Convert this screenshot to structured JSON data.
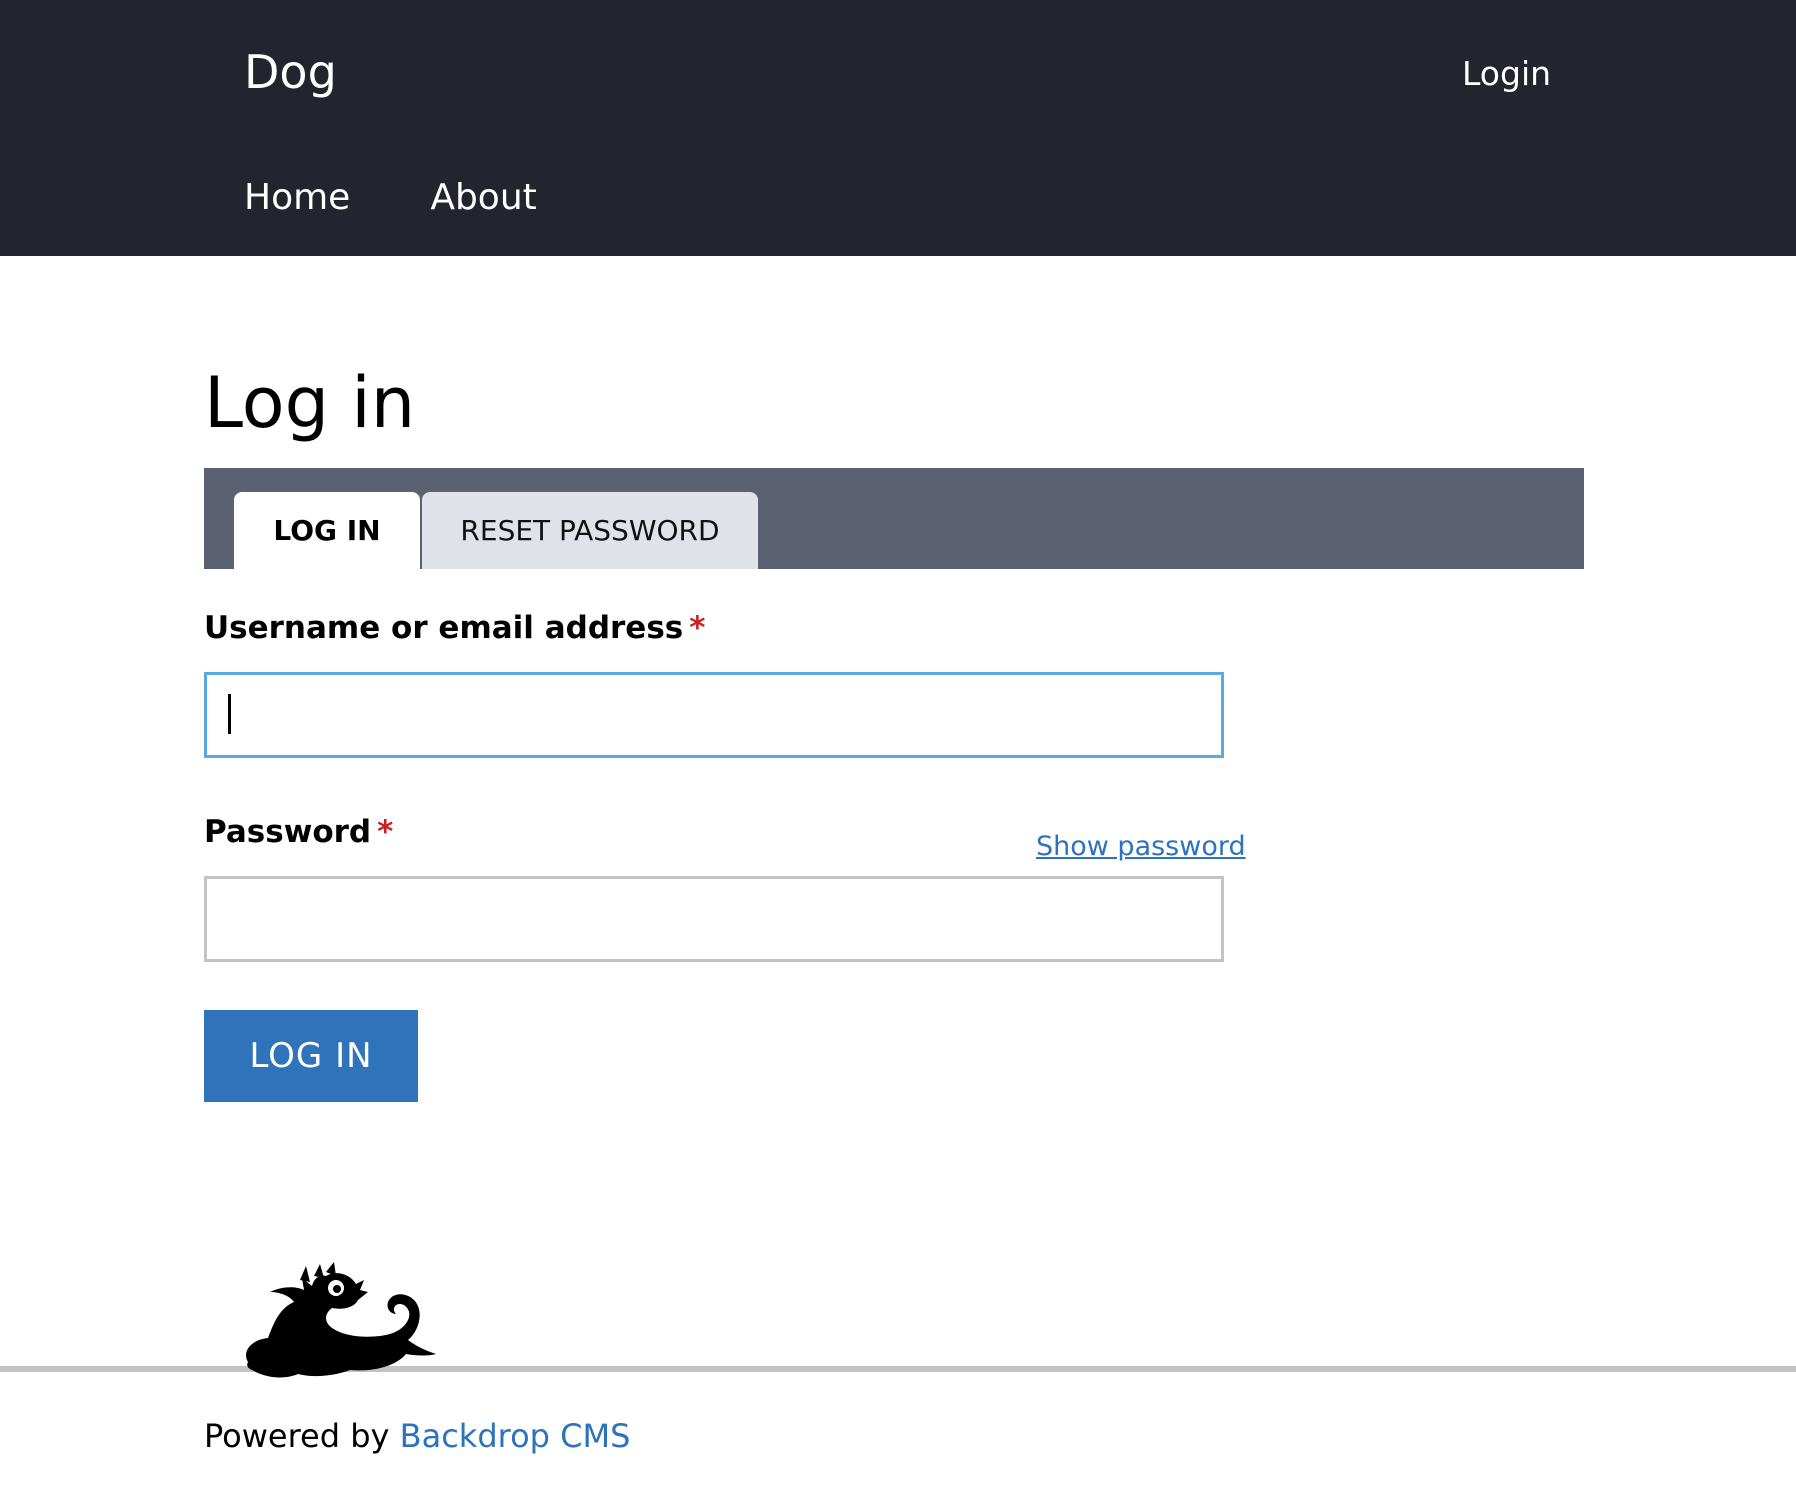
{
  "header": {
    "site_name": "Dog",
    "login_link": "Login",
    "nav": [
      {
        "label": "Home"
      },
      {
        "label": "About"
      }
    ]
  },
  "main": {
    "title": "Log in",
    "tabs": [
      {
        "label": "LOG IN",
        "active": true
      },
      {
        "label": "RESET PASSWORD",
        "active": false
      }
    ],
    "form": {
      "username_label": "Username or email address",
      "username_value": "",
      "password_label": "Password",
      "password_value": "",
      "required_marker": "*",
      "show_password": "Show password",
      "submit_label": "LOG IN"
    }
  },
  "footer": {
    "powered_by": "Powered by",
    "cms_link": "Backdrop CMS",
    "logo": "backdrop-drop-mascot-icon"
  },
  "colors": {
    "header_bg": "#22252e",
    "tabs_bar_bg": "#5b6170",
    "inactive_tab_bg": "#e0e2ea",
    "accent_blue": "#2f73bb",
    "focus_border": "#5aa9e4",
    "required_red": "#cc1f1f"
  }
}
